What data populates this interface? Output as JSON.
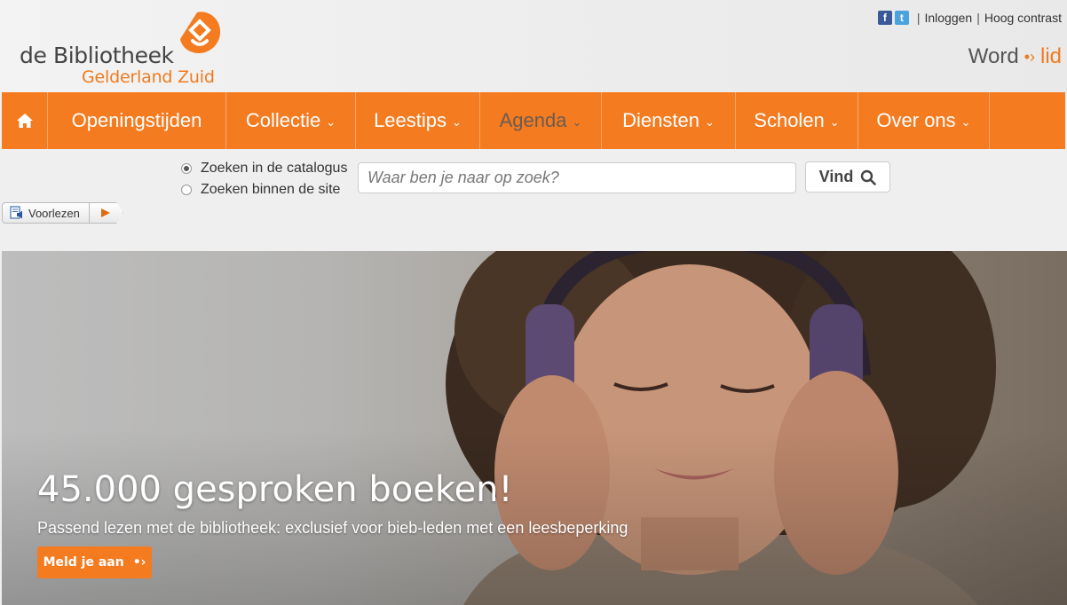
{
  "brand": {
    "line1": "de Bibliotheek",
    "line2": "Gelderland Zuid",
    "accent": "#f47b20"
  },
  "toplinks": {
    "social": [
      {
        "icon": "facebook-icon",
        "glyph": "f"
      },
      {
        "icon": "twitter-icon",
        "glyph": "t"
      }
    ],
    "login": "Inloggen",
    "contrast": "Hoog contrast"
  },
  "join": {
    "word": "Word",
    "lid": "lid",
    "arrow": "•›"
  },
  "nav": {
    "home_icon": "home-icon",
    "items": [
      {
        "label": "Openingstijden",
        "dropdown": false
      },
      {
        "label": "Collectie",
        "dropdown": true
      },
      {
        "label": "Leestips",
        "dropdown": true
      },
      {
        "label": "Agenda",
        "dropdown": true,
        "active": true
      },
      {
        "label": "Diensten",
        "dropdown": true
      },
      {
        "label": "Scholen",
        "dropdown": true
      },
      {
        "label": "Over ons",
        "dropdown": true
      }
    ],
    "caret": "⌄"
  },
  "search": {
    "options": [
      {
        "label": "Zoeken in de catalogus",
        "checked": true
      },
      {
        "label": "Zoeken binnen de site",
        "checked": false
      }
    ],
    "placeholder": "Waar ben je naar op zoek?",
    "value": "",
    "button": "Vind"
  },
  "readspeaker": {
    "label": "Voorlezen"
  },
  "hero": {
    "title": "45.000 gesproken boeken!",
    "subtitle": "Passend lezen met de bibliotheek: exclusief voor bieb-leden met een leesbeperking",
    "cta": "Meld je aan",
    "cta_arrow": "•›"
  }
}
